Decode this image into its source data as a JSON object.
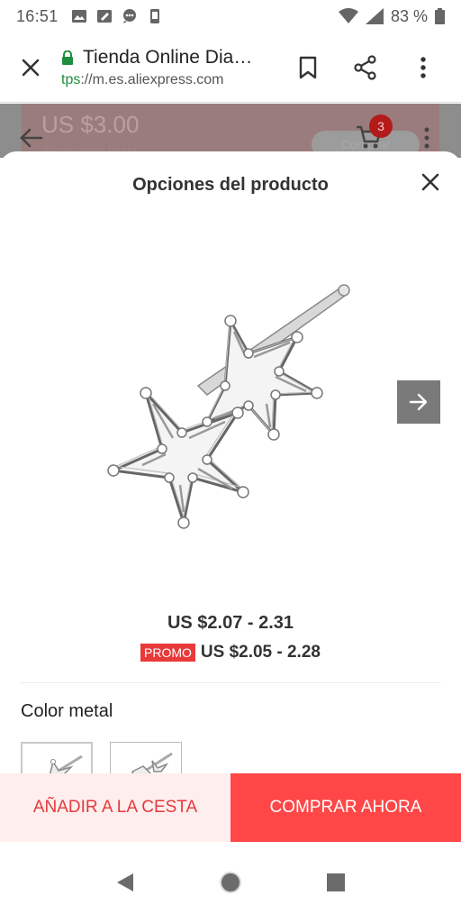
{
  "status_bar": {
    "time": "16:51",
    "battery": "83 %"
  },
  "browser": {
    "title": "Tienda Online Dia…",
    "url_scheme": "tps",
    "url_rest": "://m.es.aliexpress.com"
  },
  "background_page": {
    "price": "US $3.00",
    "subtitle": "Envío gratis hasta",
    "cart_count": "3",
    "pill_label": "Comprar"
  },
  "sheet": {
    "title": "Opciones del producto",
    "price_range": "US $2.07 - 2.31",
    "promo_badge": "PROMO",
    "promo_price": "US $2.05 - 2.28",
    "color_label": "Color metal"
  },
  "actions": {
    "add_to_cart": "AÑADIR A LA CESTA",
    "buy_now": "COMPRAR AHORA"
  },
  "colors": {
    "accent": "#ff4747",
    "accent_light": "#ffeeee",
    "secure_green": "#1e8e3e",
    "promo_red": "#e93a3a"
  },
  "icons": {
    "close": "close-icon",
    "lock": "lock-icon",
    "bookmark": "bookmark-icon",
    "share": "share-icon",
    "more": "more-vert-icon",
    "next": "arrow-right-icon",
    "nav_back": "triangle-back-icon",
    "nav_home": "circle-home-icon",
    "nav_recents": "square-recents-icon"
  }
}
